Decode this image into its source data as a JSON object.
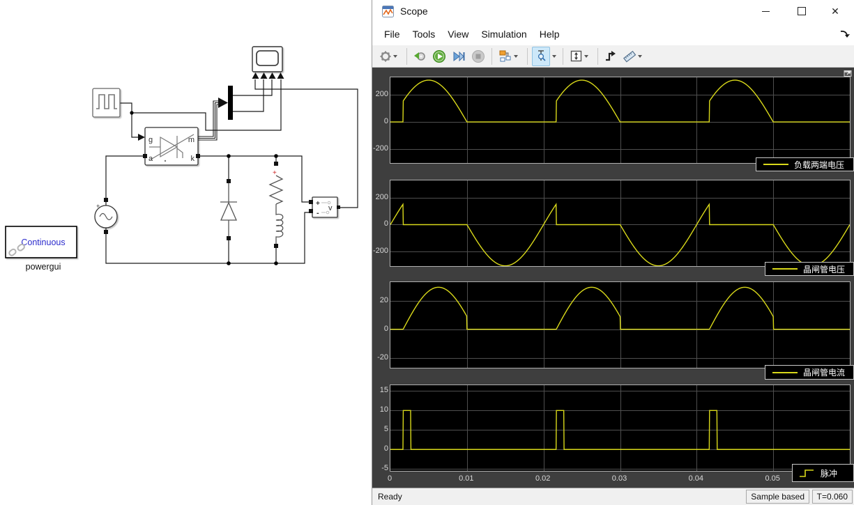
{
  "window": {
    "title": "Scope",
    "menu": [
      "File",
      "Tools",
      "View",
      "Simulation",
      "Help"
    ],
    "status_left": "Ready",
    "status_mode": "Sample based",
    "status_time": "T=0.060"
  },
  "icons": {
    "close": "✕",
    "toolbar": [
      "settings-gear-icon",
      "simulink-snapshot-icon",
      "run-icon",
      "step-forward-icon",
      "stop-icon",
      "signal-selector-icon",
      "cursor-measurements-icon",
      "span-zoom-icon",
      "trigger-icon",
      "measurements-ruler-icon",
      "dock-arrow-icon",
      "popout-icon"
    ]
  },
  "colors": {
    "trace": "#d9d91a",
    "axes_bg": "#000000",
    "canvas_bg": "#3e3e3e",
    "grid": "#4f4f4f",
    "tick_label": "#d9d9d9",
    "selected_tool_bg": "#cde8f9",
    "powergui_text": "#2b2bcc",
    "load_polarity": "#cc2222"
  },
  "chart_data": [
    {
      "type": "line",
      "legend": "负载两端电压",
      "legend_position": "bottom-right",
      "grid": true,
      "xlim": [
        0,
        0.06
      ],
      "ylim": [
        -305,
        332
      ],
      "yticks": [
        200,
        0,
        -200
      ],
      "signal": {
        "kind": "rectified_half_sine",
        "amplitude": 311,
        "frequency_hz": 50,
        "period_s": 0.02,
        "firing_time_s": 0.001667
      },
      "key_points": [
        [
          0,
          0
        ],
        [
          0.001667,
          155
        ],
        [
          0.005,
          311
        ],
        [
          0.01,
          0
        ],
        [
          0.021667,
          155
        ],
        [
          0.025,
          311
        ],
        [
          0.03,
          0
        ],
        [
          0.041667,
          155
        ],
        [
          0.045,
          311
        ],
        [
          0.05,
          0
        ],
        [
          0.06,
          0
        ]
      ]
    },
    {
      "type": "line",
      "legend": "晶闸管电压",
      "legend_position": "bottom-right",
      "grid": true,
      "xlim": [
        0,
        0.06
      ],
      "ylim": [
        -313,
        334
      ],
      "yticks": [
        200,
        0,
        -200
      ],
      "signal": {
        "kind": "thyristor_voltage",
        "amplitude": 311,
        "frequency_hz": 50,
        "period_s": 0.02,
        "firing_time_s": 0.001667
      },
      "key_points": [
        [
          0,
          0
        ],
        [
          0.001667,
          155
        ],
        [
          0.0017,
          0
        ],
        [
          0.01,
          0
        ],
        [
          0.015,
          -311
        ],
        [
          0.02,
          0
        ],
        [
          0.021667,
          155
        ],
        [
          0.0217,
          0
        ],
        [
          0.035,
          -311
        ],
        [
          0.041667,
          155
        ],
        [
          0.055,
          -311
        ],
        [
          0.06,
          0
        ]
      ]
    },
    {
      "type": "line",
      "legend": "晶闸管电流",
      "legend_position": "bottom-right",
      "grid": true,
      "xlim": [
        0,
        0.06
      ],
      "ylim": [
        -27,
        33
      ],
      "yticks": [
        20,
        0,
        -20
      ],
      "signal": {
        "kind": "thyristor_current",
        "peak": 29.4,
        "turn_on_s": 0.001667,
        "turn_off_s": 0.01,
        "period_s": 0.02,
        "shape_width_s": 0.00923
      },
      "key_points": [
        [
          0,
          0
        ],
        [
          0.001667,
          0
        ],
        [
          0.0063,
          29.4
        ],
        [
          0.00999,
          8.8
        ],
        [
          0.01,
          0
        ],
        [
          0.021667,
          0
        ],
        [
          0.0263,
          29.4
        ],
        [
          0.03,
          0
        ],
        [
          0.041667,
          0
        ],
        [
          0.0463,
          29.4
        ],
        [
          0.05,
          0
        ]
      ]
    },
    {
      "type": "line",
      "legend": "脉冲",
      "legend_marker": "step",
      "legend_position": "bottom-right",
      "grid": true,
      "xlim": [
        0,
        0.06
      ],
      "ylim": [
        -5.5,
        16.5
      ],
      "yticks": [
        15,
        10,
        5,
        0,
        -5
      ],
      "xticks": [
        0,
        0.01,
        0.02,
        0.03,
        0.04,
        0.05
      ],
      "xtick_labels": [
        "0",
        "0.01",
        "0.02",
        "0.03",
        "0.04",
        "0.05"
      ],
      "signal": {
        "kind": "pulse_train",
        "high": 10,
        "low": 0,
        "delay_s": 0.001667,
        "width_s": 0.001,
        "period_s": 0.02
      },
      "key_points": [
        [
          0,
          0
        ],
        [
          0.001667,
          10
        ],
        [
          0.002667,
          0
        ],
        [
          0.021667,
          10
        ],
        [
          0.022667,
          0
        ],
        [
          0.041667,
          10
        ],
        [
          0.042667,
          0
        ],
        [
          0.06,
          0
        ]
      ]
    }
  ],
  "diagram": {
    "powergui": {
      "mode": "Continuous",
      "label": "powergui"
    },
    "thyristor": {
      "gate": "g",
      "anode": "a",
      "measure": "m",
      "cathode": "k"
    },
    "voltmeter": {
      "plus": "+",
      "minus": "-",
      "label": "v"
    },
    "source": {
      "plus": "+"
    },
    "load": {
      "plus": "+"
    }
  }
}
